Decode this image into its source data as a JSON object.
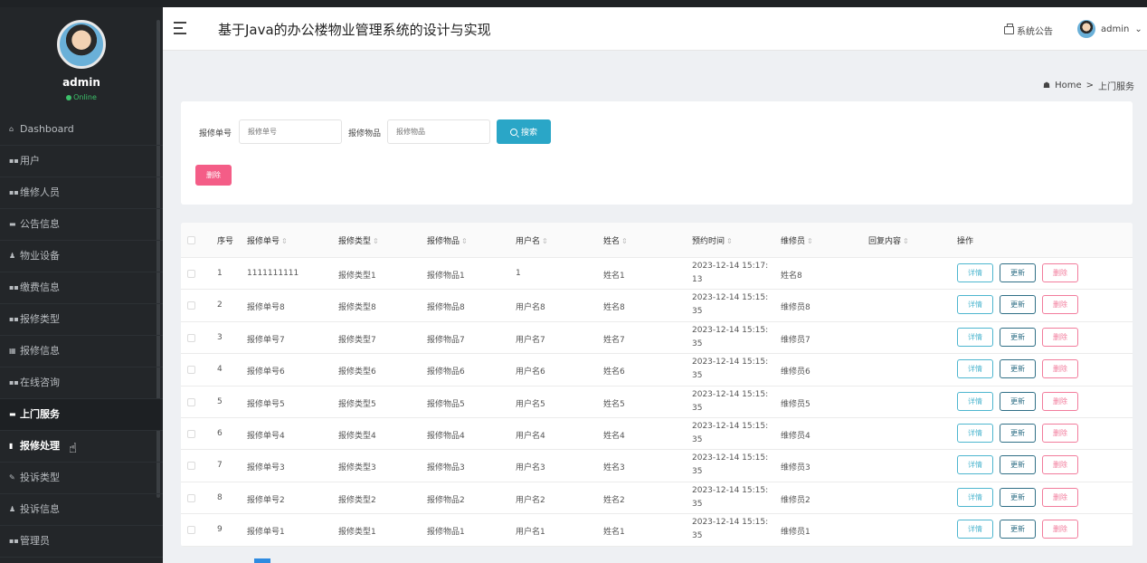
{
  "app": {
    "title": "基于Java的办公楼物业管理系统的设计与实现"
  },
  "user": {
    "name": "admin",
    "status": "Online"
  },
  "sidebar": {
    "items": [
      {
        "label": "Dashboard",
        "icon": "home-icon",
        "glyph": "⌂"
      },
      {
        "label": "用户",
        "icon": "grid-icon",
        "glyph": "▪▪"
      },
      {
        "label": "维修人员",
        "icon": "grid-icon",
        "glyph": "▪▪"
      },
      {
        "label": "公告信息",
        "icon": "notice-icon",
        "glyph": "▬"
      },
      {
        "label": "物业设备",
        "icon": "person-icon",
        "glyph": "♟"
      },
      {
        "label": "缴费信息",
        "icon": "grid-icon",
        "glyph": "▪▪"
      },
      {
        "label": "报修类型",
        "icon": "grid-icon",
        "glyph": "▪▪"
      },
      {
        "label": "报修信息",
        "icon": "table-icon",
        "glyph": "▦"
      },
      {
        "label": "在线咨询",
        "icon": "grid-icon",
        "glyph": "▪▪"
      },
      {
        "label": "上门服务",
        "icon": "briefcase-icon",
        "glyph": "▬"
      },
      {
        "label": "报修处理",
        "icon": "bar-chart-icon",
        "glyph": "▮"
      },
      {
        "label": "投诉类型",
        "icon": "pen-icon",
        "glyph": "✎"
      },
      {
        "label": "投诉信息",
        "icon": "person-icon",
        "glyph": "♟"
      },
      {
        "label": "管理员",
        "icon": "grid-icon",
        "glyph": "▪▪"
      }
    ]
  },
  "header": {
    "notice_label": "系统公告",
    "admin_label": "admin",
    "admin_caret": "⌄"
  },
  "breadcrumb": {
    "home": "Home",
    "sep": ">",
    "current": "上门服务"
  },
  "search": {
    "field1_label": "报修单号",
    "field1_placeholder": "报修单号",
    "field2_label": "报修物品",
    "field2_placeholder": "报修物品",
    "search_button": "搜索",
    "delete_button": "删除"
  },
  "table": {
    "headers": [
      "序号",
      "报修单号",
      "报修类型",
      "报修物品",
      "用户名",
      "姓名",
      "预约时间",
      "维修员",
      "回复内容",
      "操作"
    ],
    "sort_glyph": "⇕",
    "actions": {
      "detail": "详情",
      "update": "更新",
      "delete": "删除"
    },
    "rows": [
      {
        "no": "1",
        "order": "1111111111",
        "type": "报修类型1",
        "item": "报修物品1",
        "username": "1",
        "name": "姓名1",
        "time": "2023-12-14 15:17:13",
        "repairer": "姓名8",
        "reply": ""
      },
      {
        "no": "2",
        "order": "报修单号8",
        "type": "报修类型8",
        "item": "报修物品8",
        "username": "用户名8",
        "name": "姓名8",
        "time": "2023-12-14 15:15:35",
        "repairer": "维修员8",
        "reply": ""
      },
      {
        "no": "3",
        "order": "报修单号7",
        "type": "报修类型7",
        "item": "报修物品7",
        "username": "用户名7",
        "name": "姓名7",
        "time": "2023-12-14 15:15:35",
        "repairer": "维修员7",
        "reply": ""
      },
      {
        "no": "4",
        "order": "报修单号6",
        "type": "报修类型6",
        "item": "报修物品6",
        "username": "用户名6",
        "name": "姓名6",
        "time": "2023-12-14 15:15:35",
        "repairer": "维修员6",
        "reply": ""
      },
      {
        "no": "5",
        "order": "报修单号5",
        "type": "报修类型5",
        "item": "报修物品5",
        "username": "用户名5",
        "name": "姓名5",
        "time": "2023-12-14 15:15:35",
        "repairer": "维修员5",
        "reply": ""
      },
      {
        "no": "6",
        "order": "报修单号4",
        "type": "报修类型4",
        "item": "报修物品4",
        "username": "用户名4",
        "name": "姓名4",
        "time": "2023-12-14 15:15:35",
        "repairer": "维修员4",
        "reply": ""
      },
      {
        "no": "7",
        "order": "报修单号3",
        "type": "报修类型3",
        "item": "报修物品3",
        "username": "用户名3",
        "name": "姓名3",
        "time": "2023-12-14 15:15:35",
        "repairer": "维修员3",
        "reply": ""
      },
      {
        "no": "8",
        "order": "报修单号2",
        "type": "报修类型2",
        "item": "报修物品2",
        "username": "用户名2",
        "name": "姓名2",
        "time": "2023-12-14 15:15:35",
        "repairer": "维修员2",
        "reply": ""
      },
      {
        "no": "9",
        "order": "报修单号1",
        "type": "报修类型1",
        "item": "报修物品1",
        "username": "用户名1",
        "name": "姓名1",
        "time": "2023-12-14 15:15:35",
        "repairer": "维修员1",
        "reply": ""
      }
    ]
  },
  "colors": {
    "sidebar_bg": "#232629",
    "search_button": "#2aa6c7",
    "delete_button": "#f45d87",
    "online": "#3cc06a"
  }
}
